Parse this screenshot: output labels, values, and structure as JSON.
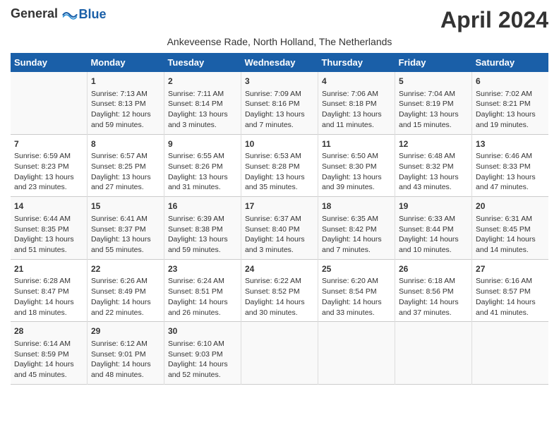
{
  "logo": {
    "general": "General",
    "blue": "Blue"
  },
  "title": "April 2024",
  "subtitle": "Ankeveense Rade, North Holland, The Netherlands",
  "days_header": [
    "Sunday",
    "Monday",
    "Tuesday",
    "Wednesday",
    "Thursday",
    "Friday",
    "Saturday"
  ],
  "weeks": [
    [
      {
        "day": "",
        "info": ""
      },
      {
        "day": "1",
        "info": "Sunrise: 7:13 AM\nSunset: 8:13 PM\nDaylight: 12 hours\nand 59 minutes."
      },
      {
        "day": "2",
        "info": "Sunrise: 7:11 AM\nSunset: 8:14 PM\nDaylight: 13 hours\nand 3 minutes."
      },
      {
        "day": "3",
        "info": "Sunrise: 7:09 AM\nSunset: 8:16 PM\nDaylight: 13 hours\nand 7 minutes."
      },
      {
        "day": "4",
        "info": "Sunrise: 7:06 AM\nSunset: 8:18 PM\nDaylight: 13 hours\nand 11 minutes."
      },
      {
        "day": "5",
        "info": "Sunrise: 7:04 AM\nSunset: 8:19 PM\nDaylight: 13 hours\nand 15 minutes."
      },
      {
        "day": "6",
        "info": "Sunrise: 7:02 AM\nSunset: 8:21 PM\nDaylight: 13 hours\nand 19 minutes."
      }
    ],
    [
      {
        "day": "7",
        "info": "Sunrise: 6:59 AM\nSunset: 8:23 PM\nDaylight: 13 hours\nand 23 minutes."
      },
      {
        "day": "8",
        "info": "Sunrise: 6:57 AM\nSunset: 8:25 PM\nDaylight: 13 hours\nand 27 minutes."
      },
      {
        "day": "9",
        "info": "Sunrise: 6:55 AM\nSunset: 8:26 PM\nDaylight: 13 hours\nand 31 minutes."
      },
      {
        "day": "10",
        "info": "Sunrise: 6:53 AM\nSunset: 8:28 PM\nDaylight: 13 hours\nand 35 minutes."
      },
      {
        "day": "11",
        "info": "Sunrise: 6:50 AM\nSunset: 8:30 PM\nDaylight: 13 hours\nand 39 minutes."
      },
      {
        "day": "12",
        "info": "Sunrise: 6:48 AM\nSunset: 8:32 PM\nDaylight: 13 hours\nand 43 minutes."
      },
      {
        "day": "13",
        "info": "Sunrise: 6:46 AM\nSunset: 8:33 PM\nDaylight: 13 hours\nand 47 minutes."
      }
    ],
    [
      {
        "day": "14",
        "info": "Sunrise: 6:44 AM\nSunset: 8:35 PM\nDaylight: 13 hours\nand 51 minutes."
      },
      {
        "day": "15",
        "info": "Sunrise: 6:41 AM\nSunset: 8:37 PM\nDaylight: 13 hours\nand 55 minutes."
      },
      {
        "day": "16",
        "info": "Sunrise: 6:39 AM\nSunset: 8:38 PM\nDaylight: 13 hours\nand 59 minutes."
      },
      {
        "day": "17",
        "info": "Sunrise: 6:37 AM\nSunset: 8:40 PM\nDaylight: 14 hours\nand 3 minutes."
      },
      {
        "day": "18",
        "info": "Sunrise: 6:35 AM\nSunset: 8:42 PM\nDaylight: 14 hours\nand 7 minutes."
      },
      {
        "day": "19",
        "info": "Sunrise: 6:33 AM\nSunset: 8:44 PM\nDaylight: 14 hours\nand 10 minutes."
      },
      {
        "day": "20",
        "info": "Sunrise: 6:31 AM\nSunset: 8:45 PM\nDaylight: 14 hours\nand 14 minutes."
      }
    ],
    [
      {
        "day": "21",
        "info": "Sunrise: 6:28 AM\nSunset: 8:47 PM\nDaylight: 14 hours\nand 18 minutes."
      },
      {
        "day": "22",
        "info": "Sunrise: 6:26 AM\nSunset: 8:49 PM\nDaylight: 14 hours\nand 22 minutes."
      },
      {
        "day": "23",
        "info": "Sunrise: 6:24 AM\nSunset: 8:51 PM\nDaylight: 14 hours\nand 26 minutes."
      },
      {
        "day": "24",
        "info": "Sunrise: 6:22 AM\nSunset: 8:52 PM\nDaylight: 14 hours\nand 30 minutes."
      },
      {
        "day": "25",
        "info": "Sunrise: 6:20 AM\nSunset: 8:54 PM\nDaylight: 14 hours\nand 33 minutes."
      },
      {
        "day": "26",
        "info": "Sunrise: 6:18 AM\nSunset: 8:56 PM\nDaylight: 14 hours\nand 37 minutes."
      },
      {
        "day": "27",
        "info": "Sunrise: 6:16 AM\nSunset: 8:57 PM\nDaylight: 14 hours\nand 41 minutes."
      }
    ],
    [
      {
        "day": "28",
        "info": "Sunrise: 6:14 AM\nSunset: 8:59 PM\nDaylight: 14 hours\nand 45 minutes."
      },
      {
        "day": "29",
        "info": "Sunrise: 6:12 AM\nSunset: 9:01 PM\nDaylight: 14 hours\nand 48 minutes."
      },
      {
        "day": "30",
        "info": "Sunrise: 6:10 AM\nSunset: 9:03 PM\nDaylight: 14 hours\nand 52 minutes."
      },
      {
        "day": "",
        "info": ""
      },
      {
        "day": "",
        "info": ""
      },
      {
        "day": "",
        "info": ""
      },
      {
        "day": "",
        "info": ""
      }
    ]
  ]
}
